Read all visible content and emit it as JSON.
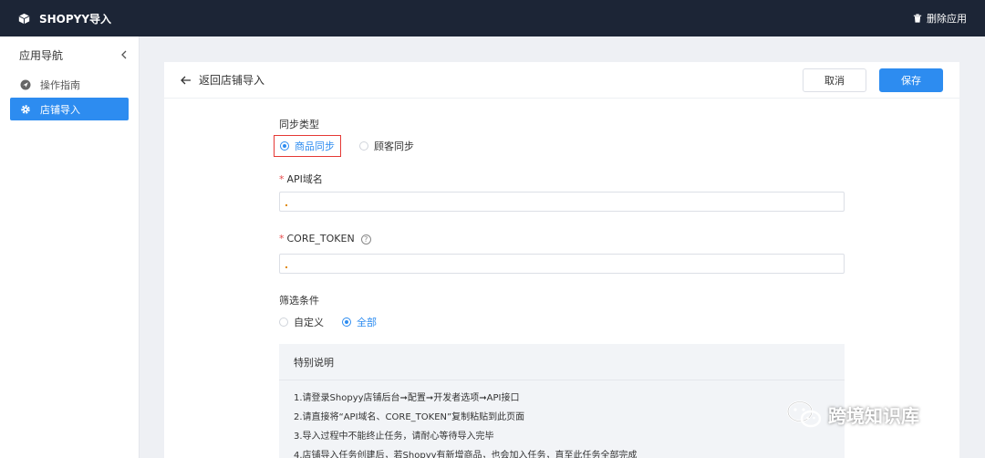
{
  "topbar": {
    "brand": "SHOPYY导入",
    "uninstall": "删除应用"
  },
  "sidebar": {
    "title": "应用导航",
    "items": [
      {
        "label": "操作指南",
        "icon": "navigation-icon",
        "active": false
      },
      {
        "label": "店铺导入",
        "icon": "gear-icon",
        "active": true
      }
    ]
  },
  "header": {
    "back_label": "返回店铺导入",
    "cancel_label": "取消",
    "save_label": "保存"
  },
  "form": {
    "sync_type": {
      "label": "同步类型",
      "options": [
        "商品同步",
        "顾客同步"
      ],
      "selected": "商品同步"
    },
    "api_domain": {
      "label": "API域名",
      "required": true,
      "value": ""
    },
    "core_token": {
      "label": "CORE_TOKEN",
      "required": true,
      "value": ""
    },
    "filter": {
      "label": "筛选条件",
      "options": [
        "自定义",
        "全部"
      ],
      "selected": "全部"
    }
  },
  "notes": {
    "title": "特别说明",
    "items": [
      "1.请登录Shopyy店铺后台➞配置➞开发者选项➞API接口",
      "2.请直接将“API域名、CORE_TOKEN”复制粘贴到此页面",
      "3.导入过程中不能终止任务，请耐心等待导入完毕",
      "4.店铺导入任务创建后，若Shopyy有新增商品，也会加入任务，直至此任务全部完成"
    ]
  },
  "watermark": "跨境知识库",
  "colors": {
    "topbar": "#1c2536",
    "accent": "#2d8cf0",
    "highlight": "#e53935"
  }
}
